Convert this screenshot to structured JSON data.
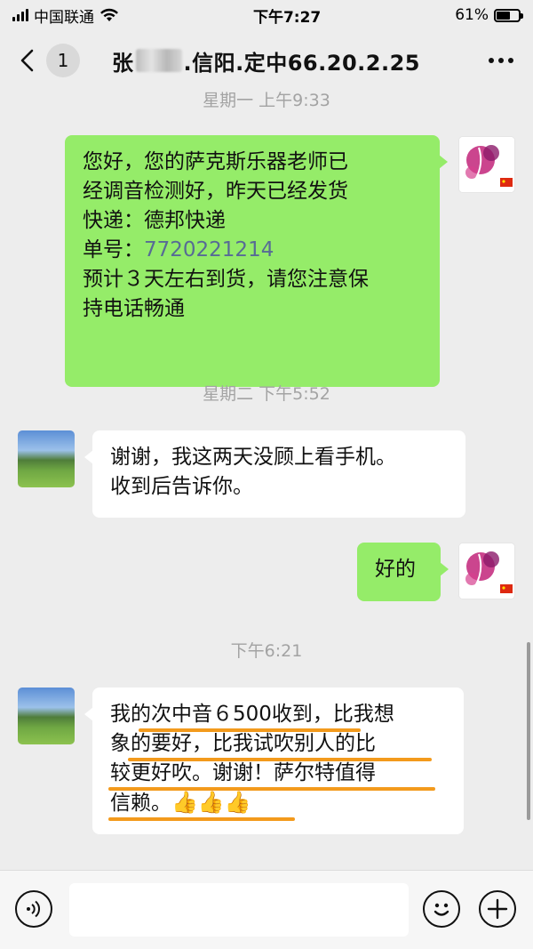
{
  "status_bar": {
    "carrier": "中国联通",
    "time": "下午7:27",
    "battery_text": "61%",
    "battery_level": 0.61
  },
  "nav": {
    "unread_count": "1",
    "title_prefix": "张",
    "title_suffix": ".信阳.定中66.20.2.25"
  },
  "messages": {
    "ts1": "星期一 上午9:33",
    "m1_lines": [
      "您好，您的萨克斯乐器老师已",
      "经调音检测好，昨天已经发货",
      "快递：德邦快递"
    ],
    "m1_number_label": "单号：",
    "m1_number": "7720221214",
    "m1_lines_after": [
      "预计３天左右到货，请您注意保",
      "持电话畅通"
    ],
    "ts2": "星期二 下午5:52",
    "m2_lines": [
      "谢谢，我这两天没顾上看手机。",
      "收到后告诉你。"
    ],
    "m3": "好的",
    "ts3": "下午6:21",
    "m4_lines": [
      "我的次中音６500收到，比我想",
      "象的要好，比我试吹别人的比",
      "较更好吹。谢谢！萨尔特值得"
    ],
    "m4_last": "信赖。",
    "m4_emoji": "👍👍👍"
  },
  "input": {
    "placeholder": "",
    "value": ""
  },
  "colors": {
    "outgoing_bubble": "#95ec69",
    "incoming_bubble": "#ffffff",
    "highlight_underline": "#f39a1c",
    "link": "#576b95"
  },
  "icons": [
    "back-chevron-icon",
    "more-icon",
    "voice-icon",
    "emoji-icon",
    "plus-icon",
    "wifi-icon",
    "signal-icon",
    "battery-icon"
  ]
}
